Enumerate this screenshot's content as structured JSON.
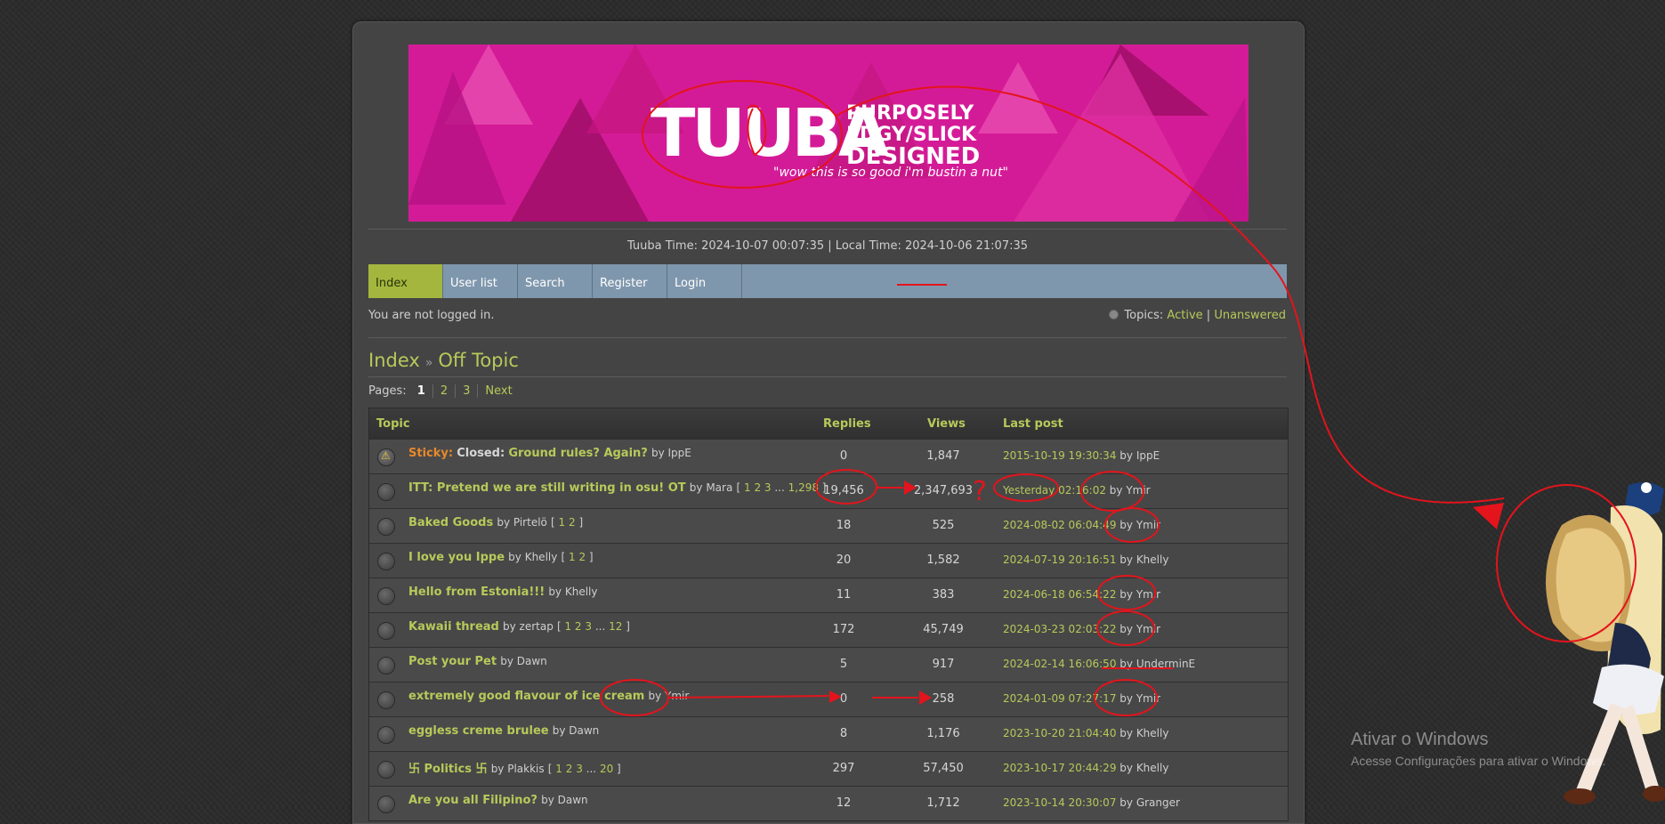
{
  "banner": {
    "logo_big": "TUUBA",
    "tag_lines": [
      "PURPOSELY",
      "EDGY/SLICK",
      "DESIGNED"
    ],
    "quote": "\"wow this is so good i'm bustin a nut\"",
    "colors": {
      "bg": "#d41b97",
      "tri_light": "#e94db1",
      "tri_dark": "#a8106f"
    }
  },
  "timebar": "Tuuba Time: 2024-10-07 00:07:35 | Local Time: 2024-10-06 21:07:35",
  "nav": [
    "Index",
    "User list",
    "Search",
    "Register",
    "Login"
  ],
  "status": "You are not logged in.",
  "topics_links": {
    "prefix": "Topics:",
    "active": "Active",
    "sep": "|",
    "unanswered": "Unanswered"
  },
  "breadcrumb": {
    "root": "Index",
    "sep": "»",
    "current": "Off Topic"
  },
  "pagination": {
    "label": "Pages:",
    "pages": [
      "1",
      "2",
      "3"
    ],
    "next": "Next"
  },
  "table": {
    "headers": {
      "topic": "Topic",
      "replies": "Replies",
      "views": "Views",
      "last_post": "Last post"
    },
    "rows": [
      {
        "sticky": "Sticky:",
        "closed": "Closed:",
        "title": "Ground rules? Again?",
        "by": "by IppE",
        "pages": "",
        "replies": "0",
        "views": "1,847",
        "lp_date": "2015-10-19 19:30:34",
        "lp_by": "by IppE"
      },
      {
        "sticky": "",
        "closed": "",
        "title": "ITT: Pretend we are still writing in osu! OT",
        "by": "by Mara",
        "pages": "1 2 3 ... 1,298",
        "replies": "19,456",
        "views": "2,347,693",
        "lp_date": "Yesterday 02:16:02",
        "lp_by": "by Ymir"
      },
      {
        "sticky": "",
        "closed": "",
        "title": "Baked Goods",
        "by": "by Pirtelö",
        "pages": "1 2",
        "replies": "18",
        "views": "525",
        "lp_date": "2024-08-02 06:04:49",
        "lp_by": "by Ymir"
      },
      {
        "sticky": "",
        "closed": "",
        "title": "I love you Ippe",
        "by": "by Khelly",
        "pages": "1 2",
        "replies": "20",
        "views": "1,582",
        "lp_date": "2024-07-19 20:16:51",
        "lp_by": "by Khelly"
      },
      {
        "sticky": "",
        "closed": "",
        "title": "Hello from Estonia!!!",
        "by": "by Khelly",
        "pages": "",
        "replies": "11",
        "views": "383",
        "lp_date": "2024-06-18 06:54:22",
        "lp_by": "by Ymir"
      },
      {
        "sticky": "",
        "closed": "",
        "title": "Kawaii thread",
        "by": "by zertap",
        "pages": "1 2 3 ... 12",
        "replies": "172",
        "views": "45,749",
        "lp_date": "2024-03-23 02:03:22",
        "lp_by": "by Ymir"
      },
      {
        "sticky": "",
        "closed": "",
        "title": "Post your Pet",
        "by": "by Dawn",
        "pages": "",
        "replies": "5",
        "views": "917",
        "lp_date": "2024-02-14 16:06:50",
        "lp_by": "by UnderminE"
      },
      {
        "sticky": "",
        "closed": "",
        "title": "extremely good flavour of ice cream",
        "by": "by Ymir",
        "pages": "",
        "replies": "0",
        "views": "258",
        "lp_date": "2024-01-09 07:27:17",
        "lp_by": "by Ymir"
      },
      {
        "sticky": "",
        "closed": "",
        "title": "eggless creme brulee",
        "by": "by Dawn",
        "pages": "",
        "replies": "8",
        "views": "1,176",
        "lp_date": "2023-10-20 21:04:40",
        "lp_by": "by Khelly"
      },
      {
        "sticky": "",
        "closed": "",
        "title": "卐 Politics 卐",
        "by": "by Plakkis",
        "pages": "1 2 3 ... 20",
        "replies": "297",
        "views": "57,450",
        "lp_date": "2023-10-17 20:44:29",
        "lp_by": "by Khelly"
      },
      {
        "sticky": "",
        "closed": "",
        "title": "Are you all Filipino?",
        "by": "by Dawn",
        "pages": "",
        "replies": "12",
        "views": "1,712",
        "lp_date": "2023-10-14 20:30:07",
        "lp_by": "by Granger"
      }
    ]
  },
  "watermark": {
    "line1": "Ativar o Windows",
    "line2": "Acesse Configurações para ativar o Windows."
  },
  "annotation": {
    "mark": "?",
    "color": "#e3141c"
  }
}
